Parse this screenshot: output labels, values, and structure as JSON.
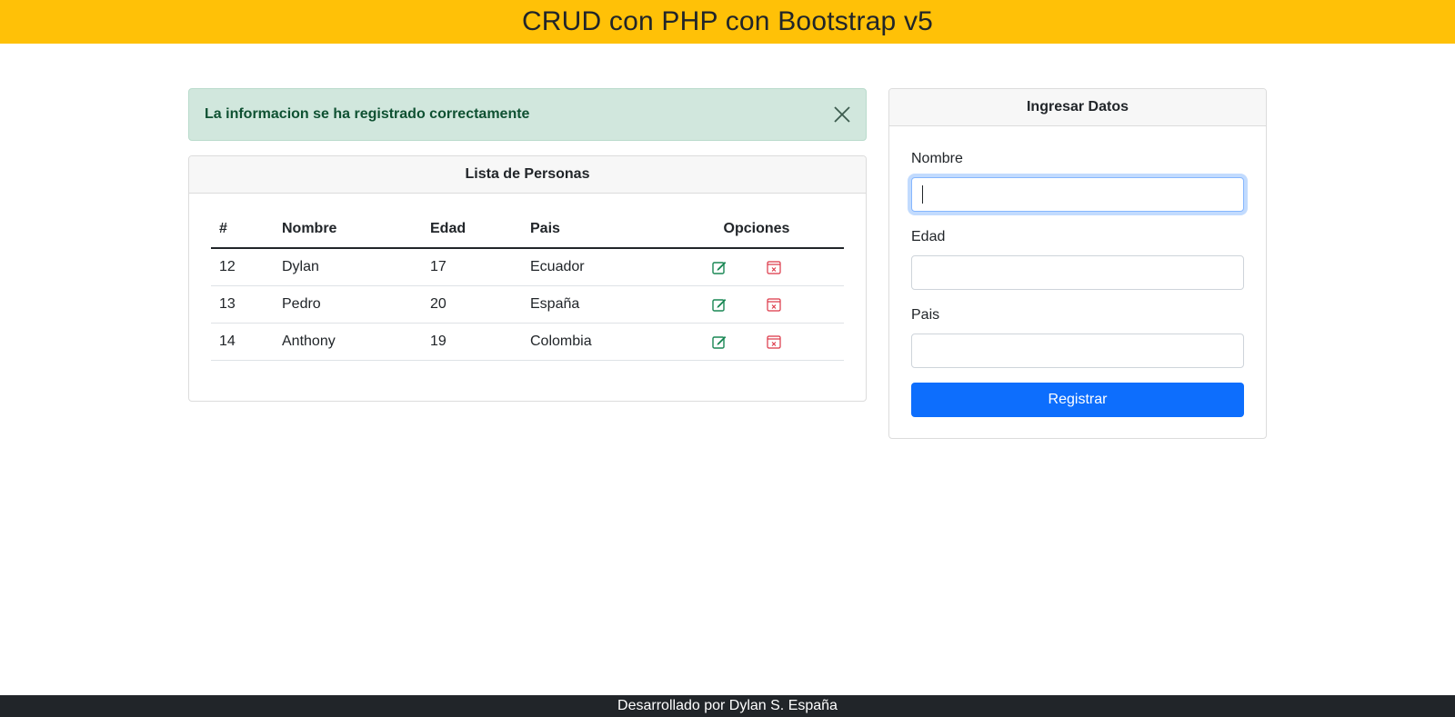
{
  "header": {
    "title": "CRUD con PHP con Bootstrap v5"
  },
  "alert": {
    "message": "La informacion se ha registrado correctamente",
    "close_icon": "close-icon",
    "color": "#d1e7dd"
  },
  "list": {
    "title": "Lista de Personas",
    "columns": [
      "#",
      "Nombre",
      "Edad",
      "Pais",
      "Opciones"
    ],
    "rows": [
      {
        "id": "12",
        "nombre": "Dylan",
        "edad": "17",
        "pais": "Ecuador"
      },
      {
        "id": "13",
        "nombre": "Pedro",
        "edad": "20",
        "pais": "España"
      },
      {
        "id": "14",
        "nombre": "Anthony",
        "edad": "19",
        "pais": "Colombia"
      }
    ],
    "edit_icon": "pencil-square-icon",
    "delete_icon": "calendar-x-icon"
  },
  "form": {
    "title": "Ingresar Datos",
    "nombre_label": "Nombre",
    "nombre_value": "",
    "edad_label": "Edad",
    "edad_value": "",
    "pais_label": "Pais",
    "pais_value": "",
    "submit_label": "Registrar"
  },
  "footer": {
    "text": "Desarrollado por Dylan S. España"
  },
  "colors": {
    "header_bg": "#ffc107",
    "primary": "#0d6efd",
    "success_icon": "#198754",
    "danger_icon": "#dc3545",
    "footer_bg": "#212529"
  }
}
